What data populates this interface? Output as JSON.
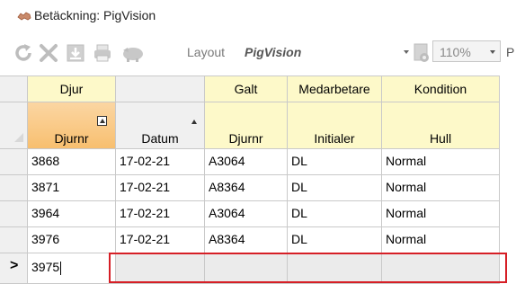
{
  "title": {
    "icon": "pig-icon",
    "text": "Betäckning: PigVision"
  },
  "toolbar": {
    "layout_label": "Layout",
    "layout_value": "PigVision",
    "zoom_value": "110%",
    "cut_label": "P"
  },
  "grid": {
    "group_headers": [
      "Djur",
      "",
      "Galt",
      "Medarbetare",
      "Kondition"
    ],
    "column_headers": [
      "Djurnr",
      "Datum",
      "Djurnr",
      "Initialer",
      "Hull"
    ],
    "rows": [
      [
        "3868",
        "17-02-21",
        "A3064",
        "DL",
        "Normal"
      ],
      [
        "3871",
        "17-02-21",
        "A8364",
        "DL",
        "Normal"
      ],
      [
        "3964",
        "17-02-21",
        "A3064",
        "DL",
        "Normal"
      ],
      [
        "3976",
        "17-02-21",
        "A8364",
        "DL",
        "Normal"
      ]
    ],
    "new_row": {
      "indicator": ">",
      "value": "3975"
    }
  },
  "colors": {
    "header_yellow": "#fdf9c9",
    "sorted_header_orange": "#f8bf6f",
    "highlight_red": "#d61f26"
  }
}
